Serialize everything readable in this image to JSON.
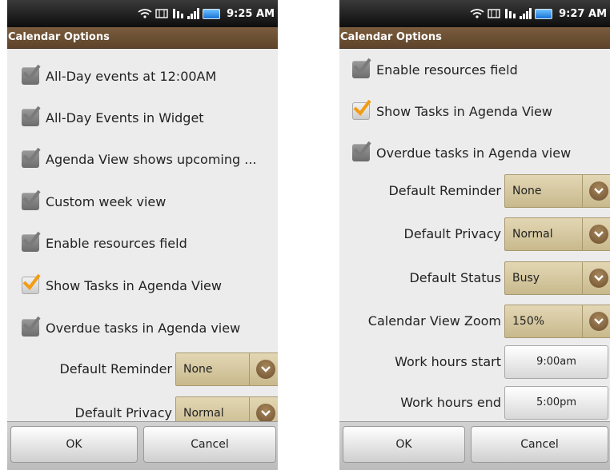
{
  "left": {
    "status_time": "9:25 AM",
    "title": "Calendar Options",
    "options": [
      {
        "label": "All-Day events at 12:00AM",
        "checked": true
      },
      {
        "label": "All-Day Events in Widget",
        "checked": true
      },
      {
        "label": "Agenda View shows upcoming ...",
        "checked": true
      },
      {
        "label": "Custom week view",
        "checked": true
      },
      {
        "label": "Enable resources field",
        "checked": true
      },
      {
        "label": "Show Tasks in Agenda View",
        "checked": true
      },
      {
        "label": "Overdue tasks in Agenda view",
        "checked": true
      }
    ],
    "selects": [
      {
        "label": "Default Reminder",
        "value": "None"
      },
      {
        "label": "Default Privacy",
        "value": "Normal"
      }
    ],
    "ok_label": "OK",
    "cancel_label": "Cancel"
  },
  "right": {
    "status_time": "9:27 AM",
    "title": "Calendar Options",
    "options": [
      {
        "label": "Enable resources field",
        "checked": true
      },
      {
        "label": "Show Tasks in Agenda View",
        "checked": true
      },
      {
        "label": "Overdue tasks in Agenda view",
        "checked": true
      }
    ],
    "selects": [
      {
        "label": "Default Reminder",
        "value": "None"
      },
      {
        "label": "Default Privacy",
        "value": "Normal"
      },
      {
        "label": "Default Status",
        "value": "Busy"
      },
      {
        "label": "Calendar View Zoom",
        "value": "150%"
      }
    ],
    "time_fields": [
      {
        "label": "Work hours start",
        "value": "9:00am"
      },
      {
        "label": "Work hours end",
        "value": "5:00pm"
      }
    ],
    "ok_label": "OK",
    "cancel_label": "Cancel"
  },
  "colors": {
    "titlebar": "#6b4f34",
    "spinner": "#d8cba3",
    "checkmark_active": "#f39c12",
    "checkmark_muted": "#7a7a7a"
  },
  "icons": [
    "wifi-icon",
    "sync-icon",
    "network-type-icon",
    "signal-icon",
    "battery-icon",
    "check-icon",
    "chevron-down-icon"
  ]
}
